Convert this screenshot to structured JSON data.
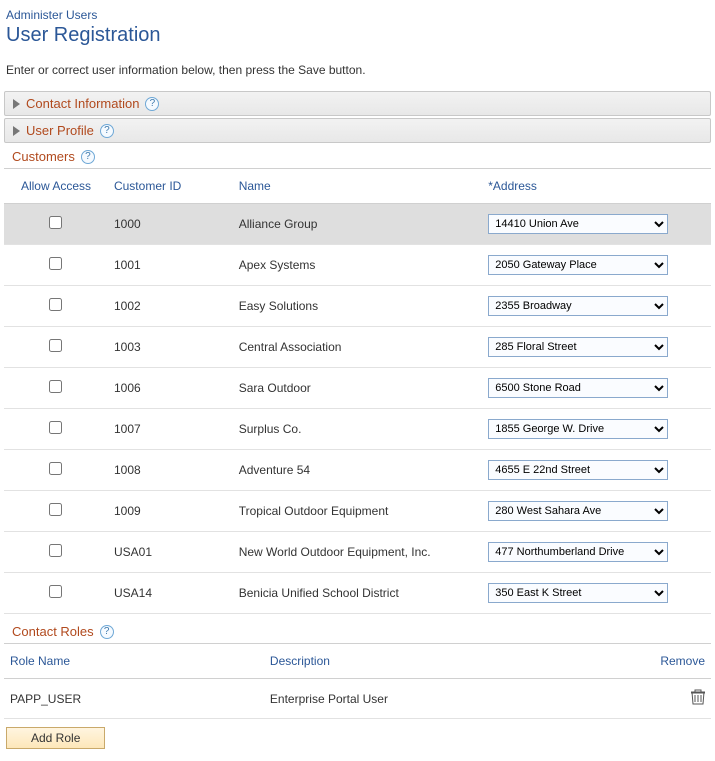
{
  "breadcrumb": "Administer Users",
  "page_title": "User Registration",
  "instruction": "Enter or correct user information below, then press the Save button.",
  "panels": {
    "contact_info": "Contact Information",
    "user_profile": "User Profile"
  },
  "customers": {
    "section_label": "Customers",
    "headers": {
      "allow_access": "Allow Access",
      "customer_id": "Customer ID",
      "name": "Name",
      "address": "*Address"
    },
    "rows": [
      {
        "id": "1000",
        "name": "Alliance Group",
        "address": "14410 Union Ave",
        "highlight": true
      },
      {
        "id": "1001",
        "name": "Apex Systems",
        "address": "2050 Gateway Place"
      },
      {
        "id": "1002",
        "name": "Easy Solutions",
        "address": "2355 Broadway"
      },
      {
        "id": "1003",
        "name": "Central Association",
        "address": "285 Floral Street"
      },
      {
        "id": "1006",
        "name": "Sara Outdoor",
        "address": "6500 Stone Road"
      },
      {
        "id": "1007",
        "name": "Surplus Co.",
        "address": "1855 George W. Drive"
      },
      {
        "id": "1008",
        "name": "Adventure 54",
        "address": "4655 E 22nd Street"
      },
      {
        "id": "1009",
        "name": "Tropical Outdoor Equipment",
        "address": "280 West Sahara Ave"
      },
      {
        "id": "USA01",
        "name": "New World Outdoor Equipment, Inc.",
        "address": "477 Northumberland Drive"
      },
      {
        "id": "USA14",
        "name": "Benicia Unified School District",
        "address": "350 East K Street"
      }
    ]
  },
  "contact_roles": {
    "section_label": "Contact Roles",
    "headers": {
      "role_name": "Role Name",
      "description": "Description",
      "remove": "Remove"
    },
    "rows": [
      {
        "role_name": "PAPP_USER",
        "description": "Enterprise Portal User"
      }
    ],
    "add_button": "Add Role"
  }
}
